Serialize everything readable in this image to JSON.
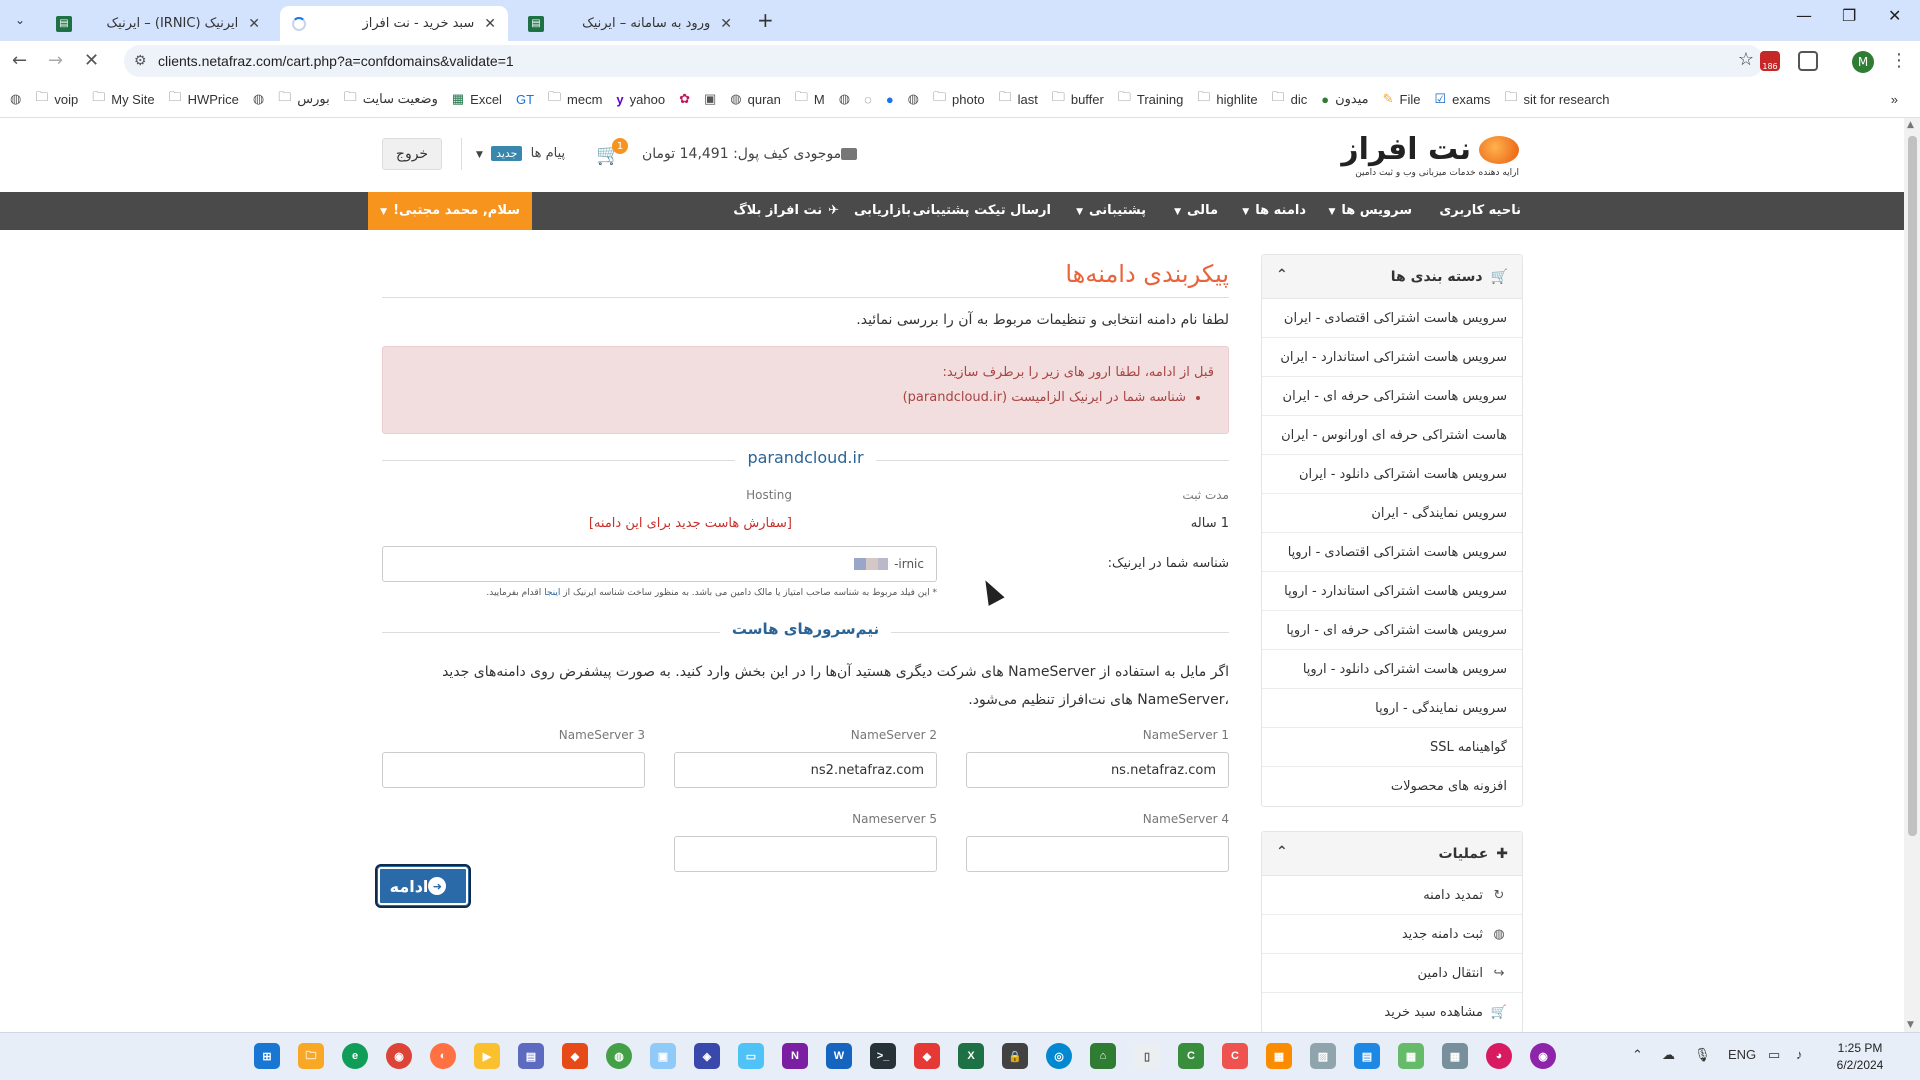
{
  "browser": {
    "tabs": [
      {
        "title": "ایرنیک (IRNIC) – ایرنیک",
        "active": false
      },
      {
        "title": "سبد خرید - نت افراز",
        "active": true
      },
      {
        "title": "ورود به سامانه – ایرنیک",
        "active": false
      }
    ],
    "url": "clients.netafraz.com/cart.php?a=confdomains&validate=1",
    "bookmarks": [
      "voip",
      "My Site",
      "HWPrice",
      "بورس",
      "وضعیت سایت",
      "Excel",
      "GT",
      "mecm",
      "yahoo",
      "quran",
      "M",
      "photo",
      "last",
      "buffer",
      "Training",
      "highlite",
      "dic",
      "میدون",
      "File",
      "exams",
      "sit for research"
    ],
    "profile_initial": "M",
    "ext_badge": "186"
  },
  "header": {
    "logo_text": "نت افراز",
    "logo_sub": "ارایه دهنده خدمات میزبانی وب و ثبت دامین",
    "wallet": "موجودی کیف پول: 14,491 تومان",
    "cart_count": "1",
    "messages_label": "پیام ها",
    "new_badge": "جدید",
    "logout": "خروج"
  },
  "nav": {
    "user_area": "ناحیه کاربری",
    "services": "سرویس ها",
    "domains": "دامنه ها",
    "finance": "مالی",
    "support": "پشتیبانی",
    "ticket": "ارسال تیکت پشتیبانی",
    "marketing": "بازاریابی",
    "blog": "نت افراز بلاگ",
    "greeting": "سلام, محمد مجتبی!"
  },
  "sidebar": {
    "categories_title": "دسته بندی ها",
    "categories": [
      "سرویس هاست اشتراکی اقتصادی - ایران",
      "سرویس هاست اشتراکی استاندارد - ایران",
      "سرویس هاست اشتراکی حرفه ای - ایران",
      "هاست اشتراکی حرفه ای اورانوس - ایران",
      "سرویس هاست اشتراکی دانلود - ایران",
      "سرویس نمایندگی - ایران",
      "سرویس هاست اشتراکی اقتصادی - اروپا",
      "سرویس هاست اشتراکی استاندارد - اروپا",
      "سرویس هاست اشتراکی حرفه ای - اروپا",
      "سرویس هاست اشتراکی دانلود - اروپا",
      "سرویس نمایندگی - اروپا",
      "گواهینامه SSL",
      "افزونه های محصولات"
    ],
    "actions_title": "عملیات",
    "actions": [
      "تمدید دامنه",
      "ثبت دامنه جدید",
      "انتقال دامین",
      "مشاهده سبد خرید"
    ]
  },
  "main": {
    "title": "پیکربندی دامنه‌ها",
    "intro": "لطفا نام دامنه انتخابی و تنظیمات مربوط به آن را بررسی نمائید.",
    "alert_title": "قبل از ادامه، لطفا ارور های زیر را برطرف سازید:",
    "alert_item": "شناسه شما در ایرنیک الزامیست (parandcloud.ir)",
    "domain": "parandcloud.ir",
    "term_label": "مدت ثبت",
    "hosting_label": "Hosting",
    "term_value": "1 ساله",
    "hosting_link": "[سفارش هاست جدید برای این دامنه]",
    "irnic_label": "شناسه شما در ایرنیک:",
    "irnic_value": "-irnic",
    "irnic_help_pre": "* این فیلد مربوط به شناسه صاحب امتیاز یا مالک دامین می باشد. به منظور ساخت شناسه ایرنیک از",
    "irnic_help_link": "اینجا",
    "irnic_help_post": "اقدام بفرمایید.",
    "ns_title": "نیم‌سرورهای هاست",
    "ns_text": "اگر مایل به استفاده از NameServer های شرکت دیگری هستید آن‌ها را در این بخش وارد کنید. به صورت پیشفرض روی دامنه‌های جدید ،NameServer های نت‌افراز تنظیم می‌شود.",
    "nameservers": [
      {
        "label": "NameServer 1",
        "value": "ns.netafraz.com"
      },
      {
        "label": "NameServer 2",
        "value": "ns2.netafraz.com"
      },
      {
        "label": "NameServer 3",
        "value": ""
      },
      {
        "label": "NameServer 4",
        "value": ""
      },
      {
        "label": "Nameserver 5",
        "value": ""
      }
    ],
    "continue": "ادامه"
  },
  "taskbar": {
    "lang": "ENG",
    "time": "1:25 PM",
    "date": "6/2/2024"
  },
  "colors": {
    "accent_orange": "#f7941d",
    "title_orange": "#e9633b",
    "nav_dark": "#4a4a4a",
    "alert_bg": "#f2dede",
    "link_blue": "#2a6496"
  }
}
